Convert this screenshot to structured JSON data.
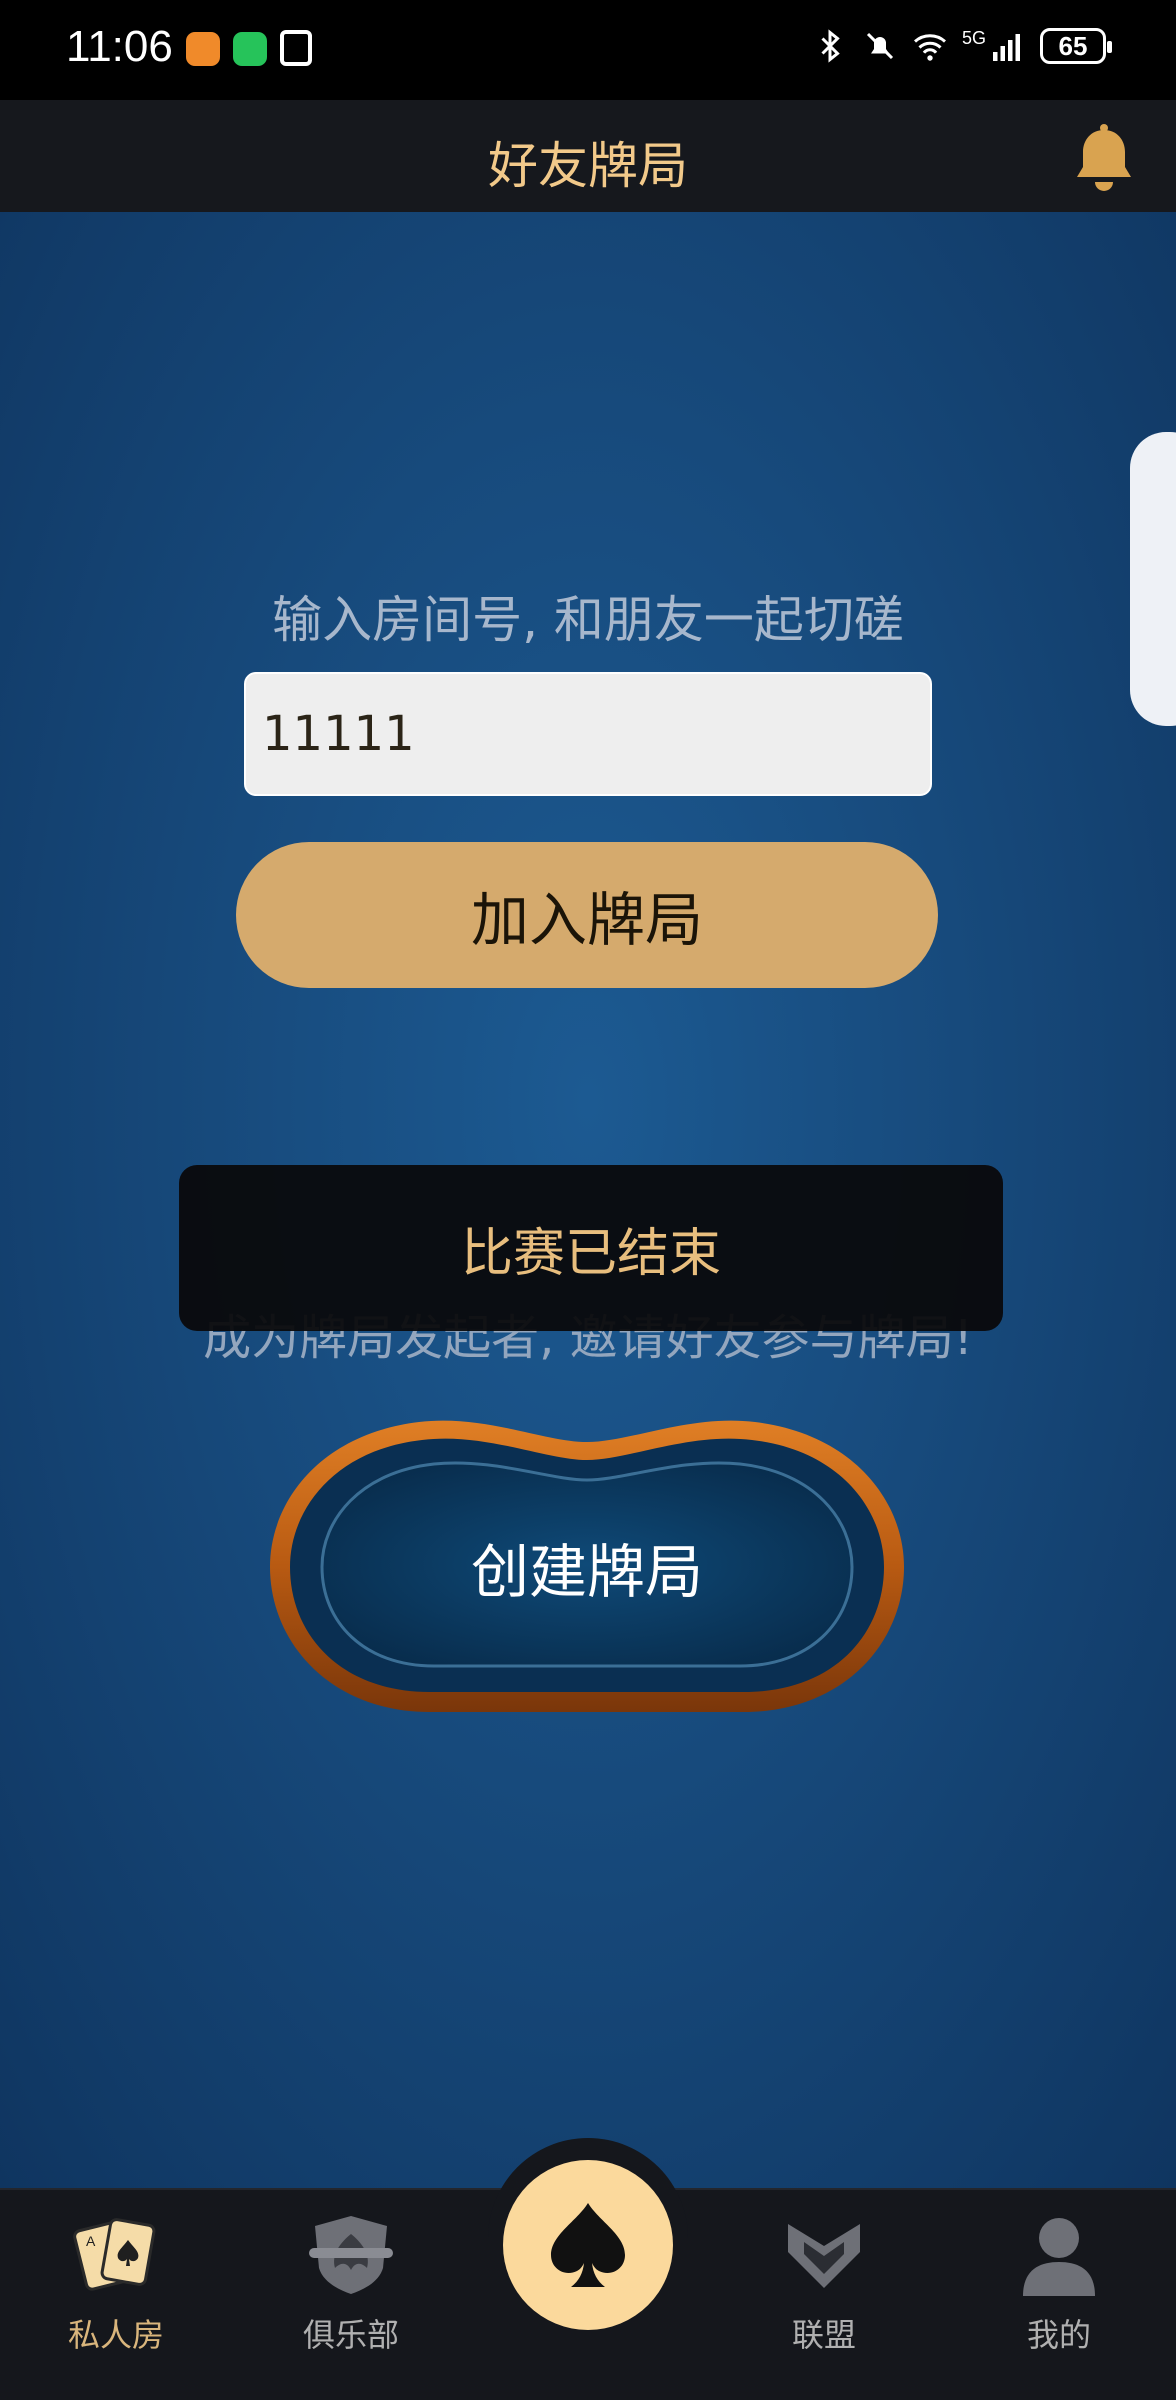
{
  "status_bar": {
    "time": "11:06",
    "battery": "65",
    "network": "5G",
    "icons": [
      "app-notification-icon",
      "wechat-icon",
      "nfc-icon",
      "bluetooth-icon",
      "mute-icon",
      "wifi-icon",
      "signal-icon",
      "battery-icon"
    ]
  },
  "header": {
    "title": "好友牌局",
    "bell_icon": "bell-icon"
  },
  "join": {
    "prompt": "输入房间号, 和朋友一起切磋",
    "room_number": "11111",
    "button_label": "加入牌局"
  },
  "toast": {
    "message": "比赛已结束"
  },
  "create": {
    "prompt": "成为牌局发起者, 邀请好友参与牌局!",
    "button_label": "创建牌局"
  },
  "bottom_nav": {
    "items": [
      {
        "label": "私人房",
        "icon": "playing-cards-icon",
        "active": true
      },
      {
        "label": "俱乐部",
        "icon": "club-crest-icon",
        "active": false
      },
      {
        "label": "",
        "icon": "spade-icon",
        "active": false
      },
      {
        "label": "联盟",
        "icon": "alliance-icon",
        "active": false
      },
      {
        "label": "我的",
        "icon": "user-icon",
        "active": false
      }
    ]
  },
  "colors": {
    "gold": "#d5aa6d",
    "title_gold": "#f2c98a",
    "felt_blue": "#174a7c",
    "nav_bg": "#15171c",
    "center_button": "#fbd99c"
  }
}
